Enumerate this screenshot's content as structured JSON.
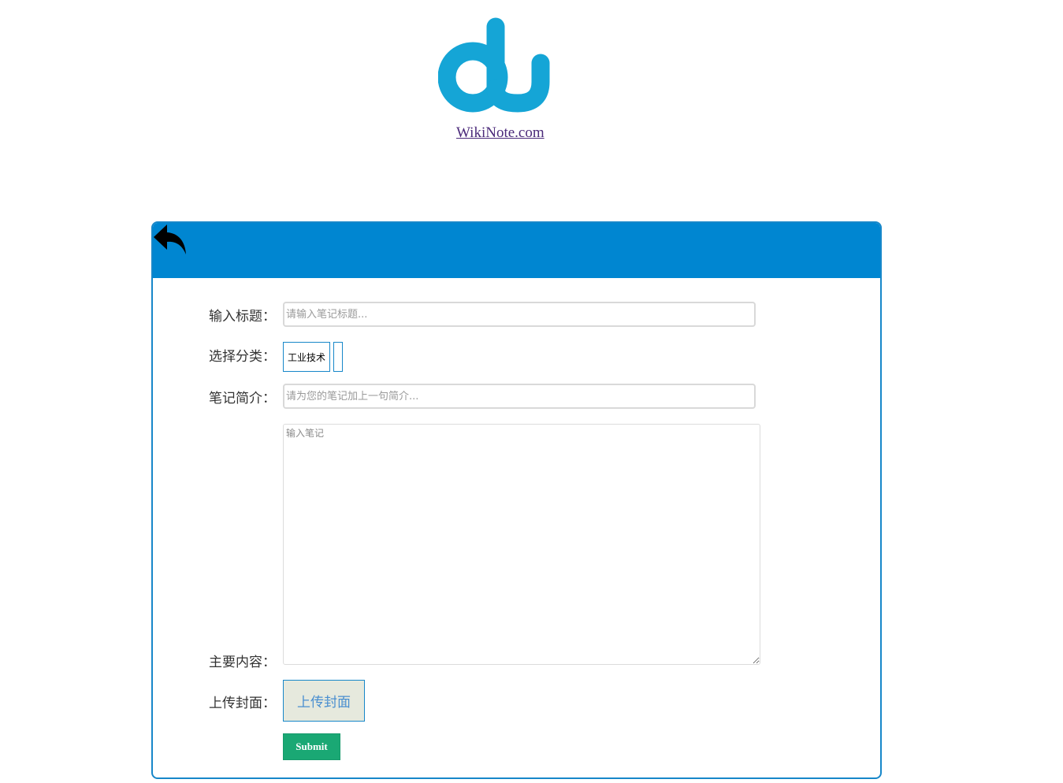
{
  "brand": {
    "link_text": "WikiNote.com",
    "logo_color": "#15a5d6",
    "logo_icon": "du-logo-icon"
  },
  "header": {
    "background_color": "#0086d1",
    "back_icon": "reply-arrow-icon"
  },
  "form": {
    "title": {
      "label": "输入标题：",
      "placeholder": "请输入笔记标题..."
    },
    "category": {
      "label": "选择分类：",
      "selected": "工业技术"
    },
    "summary": {
      "label": "笔记简介：",
      "placeholder": "请为您的笔记加上一句简介..."
    },
    "content": {
      "label": "主要内容：",
      "placeholder": "输入笔记"
    },
    "cover": {
      "label": "上传封面：",
      "button_label": "上传封面"
    },
    "submit_label": "Submit",
    "submit_color": "#1aa874"
  }
}
